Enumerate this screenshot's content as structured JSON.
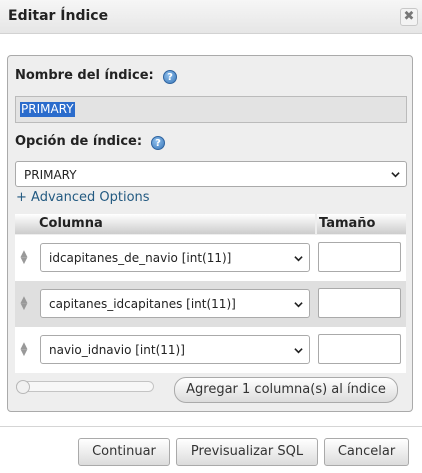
{
  "dialog": {
    "title": "Editar Índice",
    "close_label": "✖"
  },
  "form": {
    "index_name_label": "Nombre del índice:",
    "index_name_value": "PRIMARY",
    "index_option_label": "Opción de índice:",
    "index_option_value": "PRIMARY",
    "advanced_options_link": "+ Advanced Options",
    "help_icon_glyph": "?"
  },
  "columns_table": {
    "headers": [
      "Columna",
      "Tamaño"
    ],
    "rows": [
      {
        "column": "idcapitanes_de_navio [int(11)]",
        "size": ""
      },
      {
        "column": "capitanes_idcapitanes [int(11)]",
        "size": ""
      },
      {
        "column": "navio_idnavio [int(11)]",
        "size": ""
      }
    ]
  },
  "add_columns_button": "Agregar 1 columna(s) al índice",
  "scroll_level": 0,
  "footer": {
    "continue_button": "Continuar",
    "preview_sql_button": "Previsualizar SQL",
    "cancel_button": "Cancelar"
  },
  "colors": {
    "link": "#235a81",
    "selection": "#2b6ccc",
    "help_icon": "#3a77b8"
  },
  "icons": {
    "close": "close-icon",
    "help": "help-icon",
    "drag": "drag-handle-icon",
    "dropdown": "chevron-down-icon"
  }
}
